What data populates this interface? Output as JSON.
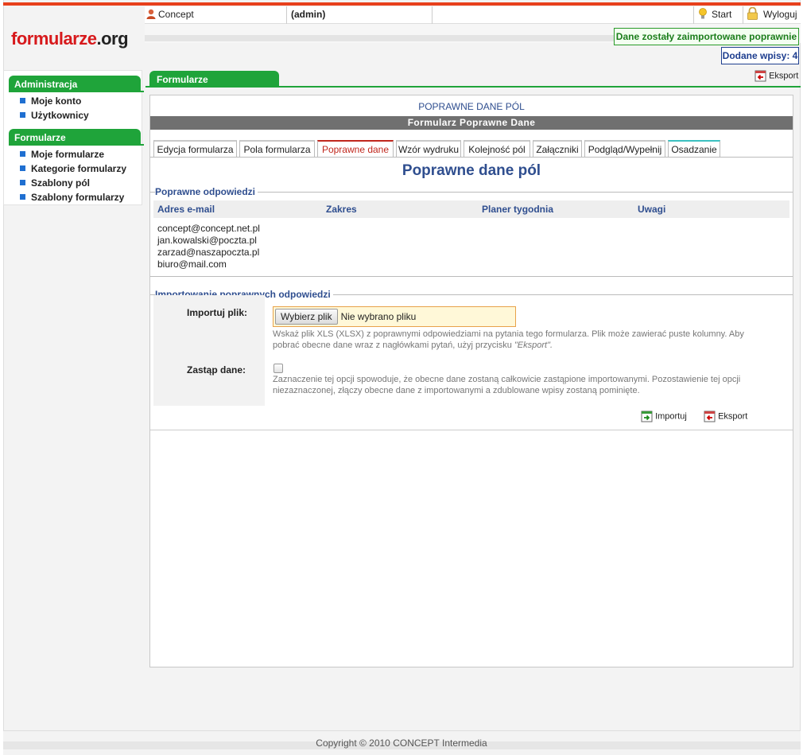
{
  "header": {
    "logo_part1": "formularze",
    "logo_part2": ".org",
    "user_name": "Concept",
    "user_role": "(admin)",
    "start_label": "Start",
    "logout_label": "Wyloguj",
    "success_message": "Dane zostały zaimportowane poprawnie",
    "count_message": "Dodane wpisy: 4"
  },
  "sidebar": {
    "sections": [
      {
        "title": "Administracja",
        "items": [
          "Moje konto",
          "Użytkownicy"
        ]
      },
      {
        "title": "Formularze",
        "items": [
          "Moje formularze",
          "Kategorie formularzy",
          "Szablony pól",
          "Szablony formularzy"
        ]
      }
    ]
  },
  "main": {
    "tab_label": "Formularze",
    "export_label": "Eksport",
    "panel_title": "POPRAWNE DANE PÓL",
    "panel_bar": "Formularz Poprawne Dane",
    "tabs": [
      "Edycja formularza",
      "Pola formularza",
      "Poprawne dane",
      "Wzór wydruku",
      "Kolejność pól",
      "Załączniki",
      "Podgląd/Wypełnij",
      "Osadzanie"
    ],
    "active_tab": "Poprawne dane",
    "heading": "Poprawne dane pól",
    "answers_legend": "Poprawne odpowiedzi",
    "columns": [
      "Adres e-mail",
      "Zakres",
      "Planer tygodnia",
      "Uwagi"
    ],
    "emails": [
      "concept@concept.net.pl",
      "jan.kowalski@poczta.pl",
      "zarzad@naszapoczta.pl",
      "biuro@mail.com"
    ],
    "import_legend": "Importowanie poprawnych odpowiedzi",
    "import_file_label": "Importuj plik:",
    "file_button": "Wybierz plik",
    "file_status": "Nie wybrano pliku",
    "file_hint_line1": "Wskaż plik XLS (XLSX) z poprawnymi odpowiedziami na pytania tego formularza. Plik może zawierać puste kolumny. Aby",
    "file_hint_line2a": "pobrać obecne dane wraz z nagłówkami pytań, użyj przycisku ",
    "file_hint_line2b": "\"Eksport\".",
    "replace_label": "Zastąp dane:",
    "replace_hint_line1": "Zaznaczenie tej opcji spowoduje, że obecne dane zostaną całkowicie zastąpione importowanymi. Pozostawienie tej opcji",
    "replace_hint_line2": "niezaznaczonej, złączy obecne dane z importowanymi a zdublowane wpisy zostaną pominięte.",
    "import_button": "Importuj",
    "export_button": "Eksport"
  },
  "footer": {
    "copyright": "Copyright © 2010 CONCEPT Intermedia"
  },
  "colors": {
    "brand_red": "#d7191c",
    "green": "#1fa43a",
    "link_blue": "#2f4e8f"
  }
}
